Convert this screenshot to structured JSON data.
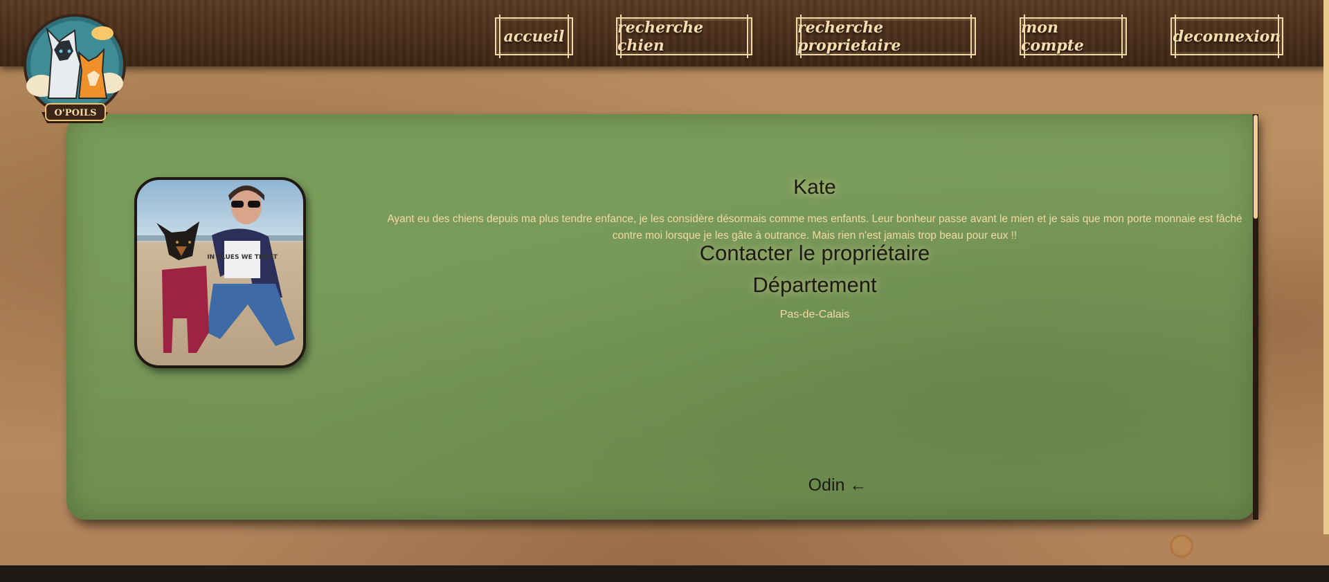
{
  "logo": {
    "text": "O'POILS"
  },
  "nav": [
    {
      "label": "accueil"
    },
    {
      "label": "recherche chien"
    },
    {
      "label": "recherche proprietaire"
    },
    {
      "label": "mon compte"
    },
    {
      "label": "deconnexion"
    }
  ],
  "profile": {
    "name": "Kate",
    "bio": "Ayant eu des chiens depuis ma plus tendre enfance, je les considère désormais comme mes enfants. Leur bonheur passe avant le mien et je sais que mon porte monnaie est fâché contre moi lorsque je les gâte à outrance. Mais rien n'est jamais trop beau pour eux !!",
    "contact_label": "Contacter le propriétaire",
    "department_title": "Département",
    "department_value": "Pas-de-Calais",
    "dog_link": "Odin ←",
    "tshirt_text": "IN BLUES WE TRUST"
  },
  "colors": {
    "header_wood": "#4a2e1a",
    "card_green": "#77975a",
    "nav_text": "#f7ddae",
    "body_text_light": "#f4d9a4",
    "heading_dark": "#1e1a14"
  }
}
